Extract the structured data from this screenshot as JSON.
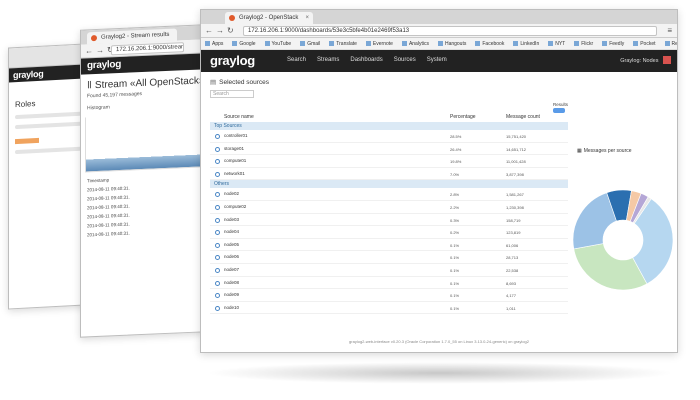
{
  "browser": {
    "tab_title": "Graylog2 - OpenStack",
    "url": "172.16.206.1:9000/dashboards/53e3c5bfe4b01e2469f53a13",
    "bookmarks": [
      "Apps",
      "Google",
      "YouTube",
      "Gmail",
      "Translate",
      "Evernote",
      "Analytics",
      "Hangouts",
      "Facebook",
      "LinkedIn",
      "NYT",
      "Flickr",
      "Feedly",
      "Pocket",
      "Readability",
      "Delicious",
      "SAP",
      "DevPortal",
      "Dev Docs"
    ]
  },
  "app": {
    "logo": "graylog",
    "nav": [
      "Search",
      "Streams",
      "Dashboards",
      "Sources",
      "System"
    ],
    "user_label": "Graylog: Nodes"
  },
  "sources": {
    "title": "Selected sources",
    "search_placeholder": "Search",
    "results_label": "Results",
    "columns": [
      "Source name",
      "Percentage",
      "Message count"
    ],
    "top_sources_label": "Top Sources",
    "top_sources": [
      {
        "name": "controller01",
        "pct": "28.5%",
        "count": "15,751,420"
      },
      {
        "name": "storage01",
        "pct": "26.4%",
        "count": "14,651,712"
      },
      {
        "name": "compute01",
        "pct": "19.8%",
        "count": "11,001,428"
      },
      {
        "name": "network01",
        "pct": "7.0%",
        "count": "3,877,398"
      }
    ],
    "others_label": "Others",
    "others": [
      {
        "name": "node02",
        "pct": "2.8%",
        "count": "1,581,267"
      },
      {
        "name": "compute02",
        "pct": "2.2%",
        "count": "1,230,398"
      },
      {
        "name": "node03",
        "pct": "0.3%",
        "count": "158,719"
      },
      {
        "name": "node04",
        "pct": "0.2%",
        "count": "123,819"
      },
      {
        "name": "node05",
        "pct": "0.1%",
        "count": "61,006"
      },
      {
        "name": "node06",
        "pct": "0.1%",
        "count": "28,713"
      },
      {
        "name": "node07",
        "pct": "0.1%",
        "count": "22,538"
      },
      {
        "name": "node08",
        "pct": "0.1%",
        "count": "8,693"
      },
      {
        "name": "node09",
        "pct": "0.1%",
        "count": "4,177"
      },
      {
        "name": "node10",
        "pct": "0.1%",
        "count": "1,011"
      }
    ],
    "footer": "graylog2-web-interface v0.20.3 (Oracle Corporation 1.7.0_55 on Linux 3.13.0-24-generic) on graylog2"
  },
  "pie": {
    "title": "Messages per source",
    "slices": [
      {
        "value": 28.5,
        "color": "#b6d7f0"
      },
      {
        "value": 26.4,
        "color": "#c8e6c0"
      },
      {
        "value": 19.8,
        "color": "#9cc2e6"
      },
      {
        "value": 7.0,
        "color": "#2b6fb0"
      },
      {
        "value": 2.8,
        "color": "#f5c9a6"
      },
      {
        "value": 2.2,
        "color": "#b5a7d6"
      },
      {
        "value": 1.0,
        "color": "#e8e8e8"
      }
    ]
  },
  "back_window_2": {
    "tab_title": "Graylog2 - Stream results",
    "url": "172.16.206.1:9000/streams",
    "stream_title": "Stream «All OpenStack»",
    "found": "Found 45,197 messages",
    "hist_title": "Histogram",
    "rows": [
      "Timestamp",
      "2014-08-11 09:40:31.",
      "2014-08-11 09:40:31.",
      "2014-08-11 09:40:31.",
      "2014-08-11 09:40:31.",
      "2014-08-11 09:40:31.",
      "2014-08-11 09:40:31."
    ]
  },
  "back_window_1": {
    "logo": "graylog",
    "heading": "Roles"
  }
}
